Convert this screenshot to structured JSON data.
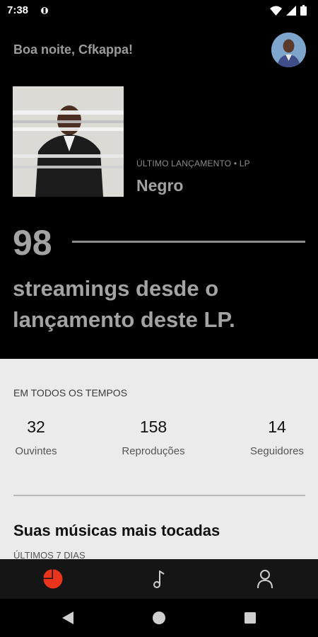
{
  "status_bar": {
    "time": "7:38",
    "icons": [
      "notification-icon",
      "wifi-icon",
      "signal-icon",
      "battery-icon"
    ]
  },
  "header": {
    "greeting": "Boa noite, Cfkappa!"
  },
  "release": {
    "kicker": "ÚLTIMO LANÇAMENTO • LP",
    "title": "Negro"
  },
  "streams": {
    "count": "98",
    "caption": "streamings desde o lançamento deste LP."
  },
  "all_time": {
    "label": "EM TODOS OS TEMPOS",
    "stats": [
      {
        "value": "32",
        "label": "Ouvintes"
      },
      {
        "value": "158",
        "label": "Reproduções"
      },
      {
        "value": "14",
        "label": "Seguidores"
      }
    ]
  },
  "top_songs": {
    "title": "Suas músicas mais tocadas",
    "subtitle": "ÚLTIMOS 7 DIAS"
  },
  "bottom_nav": {
    "items": [
      {
        "icon": "pie-chart-icon",
        "active": true
      },
      {
        "icon": "music-note-icon",
        "active": false
      },
      {
        "icon": "profile-icon",
        "active": false
      }
    ]
  },
  "colors": {
    "accent": "#e8341c",
    "background": "#000000",
    "panel": "#ebebeb",
    "nav": "#151515"
  }
}
